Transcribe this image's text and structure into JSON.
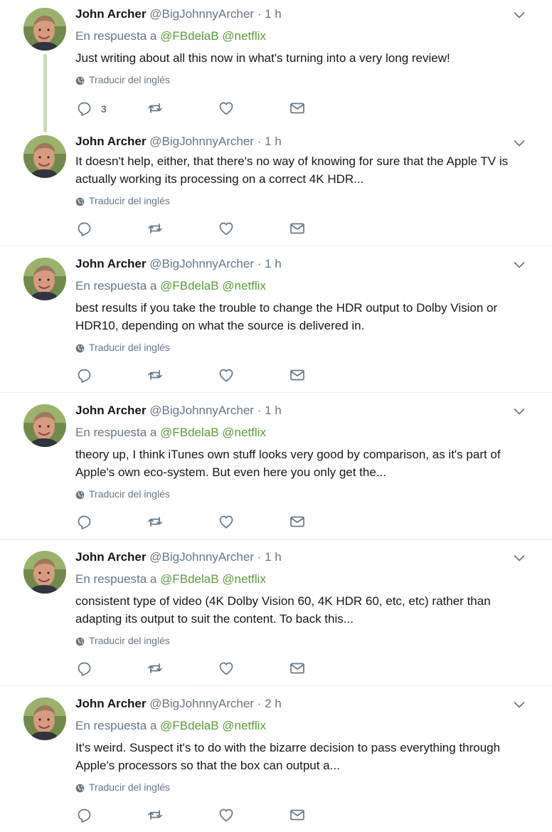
{
  "ui": {
    "reply_prefix": "En respuesta a",
    "translate_label": "Traducir del inglés",
    "separator": "·",
    "accent_color": "#5a9a3c",
    "icons": [
      "reply-icon",
      "retweet-icon",
      "like-icon",
      "message-icon",
      "globe-icon",
      "chevron-down-icon"
    ]
  },
  "tweets": [
    {
      "name": "John Archer",
      "handle": "@BigJohnnyArcher",
      "time": "1 h",
      "reply_to": [
        "@FBdelaB",
        "@netflix"
      ],
      "text": "Just writing about all this now in what's turning into a very long review!",
      "reply_count": "3",
      "threaded": true
    },
    {
      "name": "John Archer",
      "handle": "@BigJohnnyArcher",
      "time": "1 h",
      "reply_to": [],
      "text": "It doesn't help, either, that there's no way of knowing for sure that the Apple TV is actually working its processing on a correct 4K HDR...",
      "reply_count": ""
    },
    {
      "name": "John Archer",
      "handle": "@BigJohnnyArcher",
      "time": "1 h",
      "reply_to": [
        "@FBdelaB",
        "@netflix"
      ],
      "text": "best results if you take the trouble to change the HDR output to Dolby Vision or HDR10, depending on what the source is delivered in.",
      "reply_count": ""
    },
    {
      "name": "John Archer",
      "handle": "@BigJohnnyArcher",
      "time": "1 h",
      "reply_to": [
        "@FBdelaB",
        "@netflix"
      ],
      "text": "theory up, I think iTunes own stuff looks very good by comparison, as it's part of Apple's own eco-system. But even here you only get the...",
      "reply_count": ""
    },
    {
      "name": "John Archer",
      "handle": "@BigJohnnyArcher",
      "time": "1 h",
      "reply_to": [
        "@FBdelaB",
        "@netflix"
      ],
      "text": "consistent type of video (4K Dolby Vision 60, 4K HDR 60, etc, etc) rather than adapting its output to suit the content. To back this...",
      "reply_count": ""
    },
    {
      "name": "John Archer",
      "handle": "@BigJohnnyArcher",
      "time": "2 h",
      "reply_to": [
        "@FBdelaB",
        "@netflix"
      ],
      "text": "It's weird. Suspect it's to do with the bizarre decision to pass everything through Apple's processors so that the box can output a...",
      "reply_count": ""
    }
  ]
}
